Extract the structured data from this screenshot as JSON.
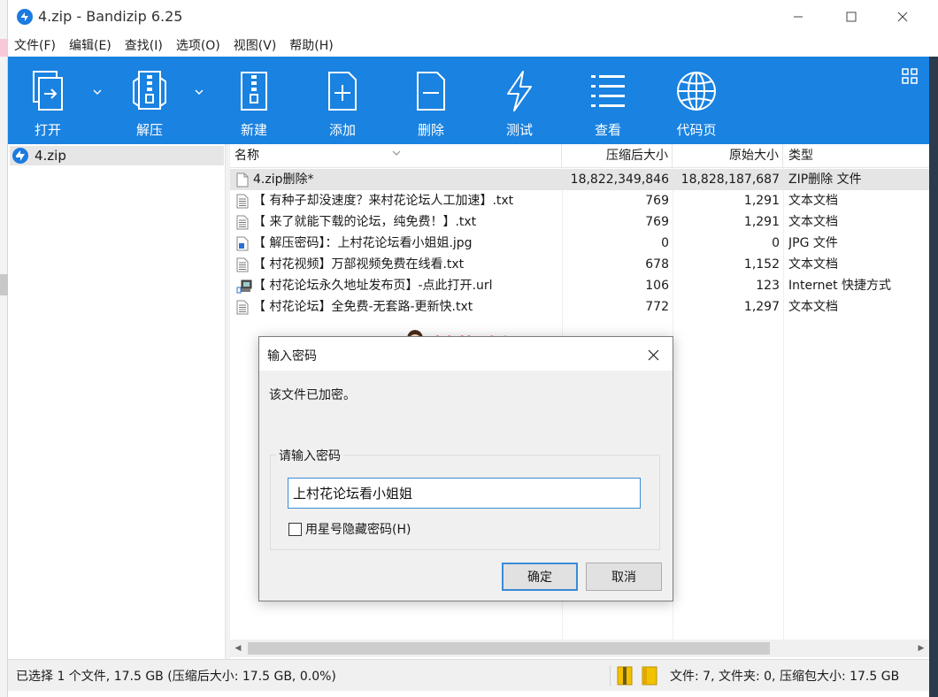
{
  "window": {
    "title": "4.zip - Bandizip 6.25"
  },
  "menu": [
    "文件(F)",
    "编辑(E)",
    "查找(I)",
    "选项(O)",
    "视图(V)",
    "帮助(H)"
  ],
  "toolbar": {
    "open": "打开",
    "extract": "解压",
    "new": "新建",
    "add": "添加",
    "delete": "删除",
    "test": "测试",
    "view": "查看",
    "codepage": "代码页"
  },
  "tree": {
    "root_label": "4.zip"
  },
  "columns": {
    "name": "名称",
    "packed": "压缩后大小",
    "original": "原始大小",
    "type": "类型"
  },
  "files": [
    {
      "name": "4.zip删除*",
      "packed": "18,822,349,846",
      "original": "18,828,187,687",
      "type": "ZIP删除 文件",
      "icon": "blank-file-icon"
    },
    {
      "name": "【 有种子却没速度？来村花论坛人工加速】.txt",
      "packed": "769",
      "original": "1,291",
      "type": "文本文档",
      "icon": "text-file-icon"
    },
    {
      "name": "【 来了就能下载的论坛，纯免费！】.txt",
      "packed": "769",
      "original": "1,291",
      "type": "文本文档",
      "icon": "text-file-icon"
    },
    {
      "name": "【 解压密码】：上村花论坛看小姐姐.jpg",
      "packed": "0",
      "original": "0",
      "type": "JPG 文件",
      "icon": "image-file-icon"
    },
    {
      "name": "【 村花视频】万部视频免费在线看.txt",
      "packed": "678",
      "original": "1,152",
      "type": "文本文档",
      "icon": "text-file-icon"
    },
    {
      "name": "【 村花论坛永久地址发布页】-点此打开.url",
      "packed": "106",
      "original": "123",
      "type": "Internet 快捷方式",
      "icon": "url-shortcut-icon"
    },
    {
      "name": "【 村花论坛】全免费-无套路-更新快.txt",
      "packed": "772",
      "original": "1,297",
      "type": "文本文档",
      "icon": "text-file-icon"
    }
  ],
  "watermark": {
    "text": "村花论坛"
  },
  "dialog": {
    "title": "输入密码",
    "message": "该文件已加密。",
    "group_label": "请输入密码",
    "password_value": "上村花论坛看小姐姐",
    "checkbox_label": "用星号隐藏密码(H)",
    "checkbox_checked": false,
    "ok_label": "确定",
    "cancel_label": "取消"
  },
  "status": {
    "left": "已选择 1 个文件, 17.5 GB (压缩后大小: 17.5 GB, 0.0%)",
    "right": "文件: 7, 文件夹: 0, 压缩包大小: 17.5 GB"
  },
  "colors": {
    "toolbar_bg": "#1a82e0",
    "watermark": "#f25b9f",
    "selection": "#e5e5e5"
  }
}
